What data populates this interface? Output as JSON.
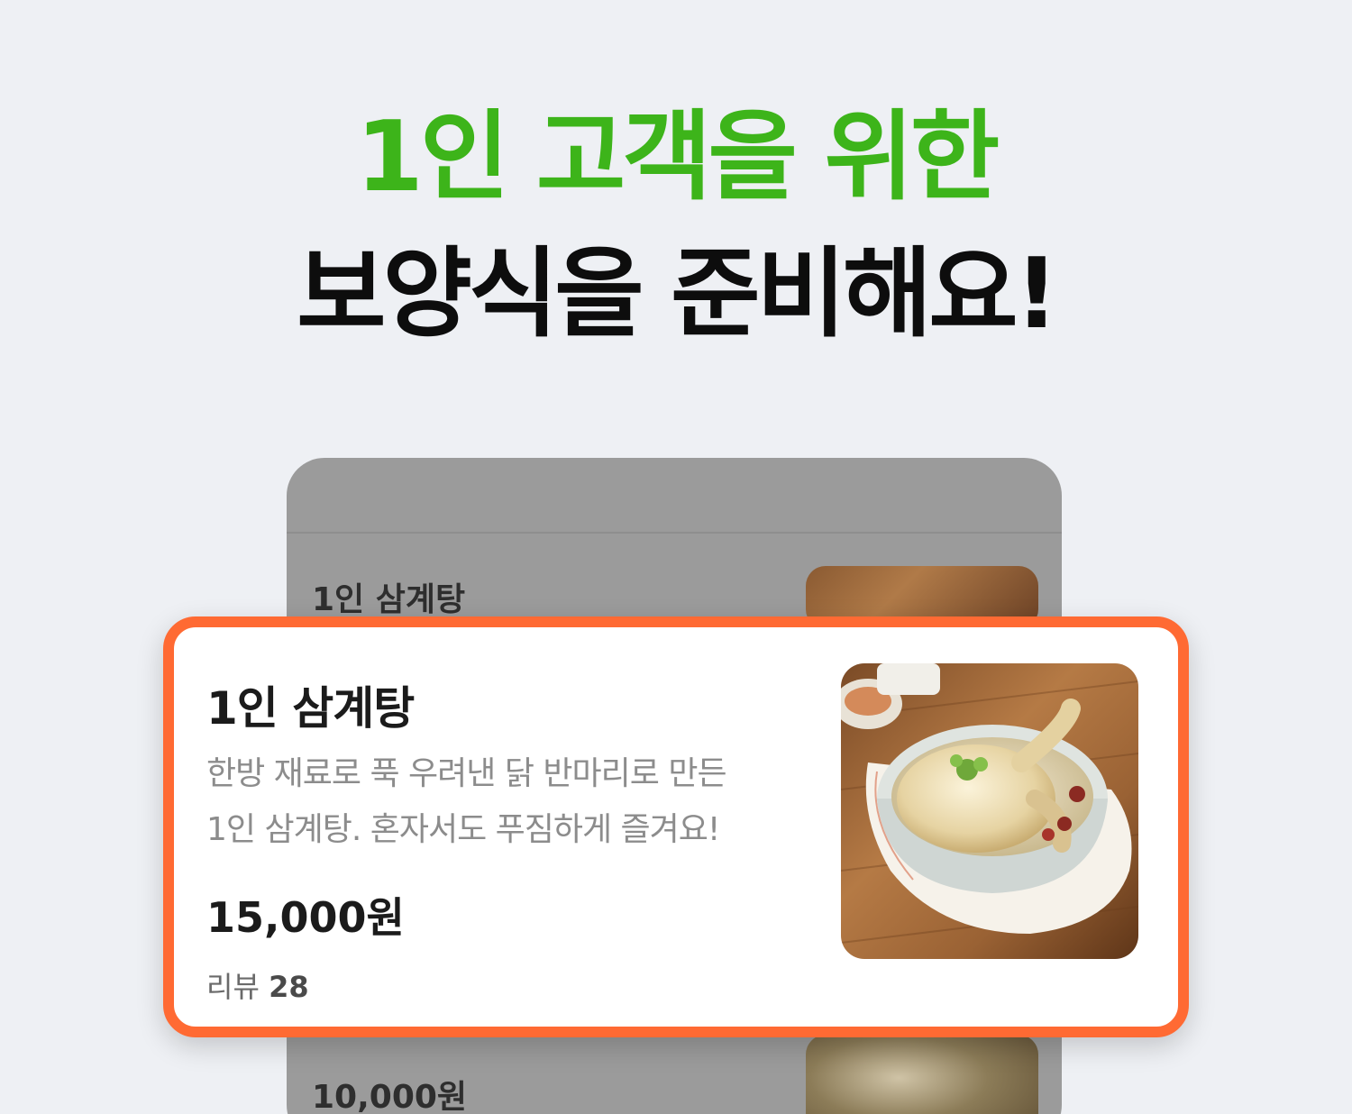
{
  "headline": {
    "line1": "1인 고객을 위한",
    "line2": "보양식을 준비해요!"
  },
  "background_card": {
    "title": "1인 삼계탕",
    "price": "10,000원"
  },
  "product_card": {
    "title": "1인 삼계탕",
    "description_line1": "한방 재료로 푹 우려낸 닭 반마리로 만든",
    "description_line2": "1인 삼계탕. 혼자서도 푸짐하게 즐겨요!",
    "price": "15,000원",
    "review_label": "리뷰",
    "review_count": "28",
    "image": "samgyetang-photo"
  },
  "colors": {
    "accent_green": "#3db41a",
    "highlight_orange": "#ff6a33",
    "background": "#eef0f4"
  }
}
